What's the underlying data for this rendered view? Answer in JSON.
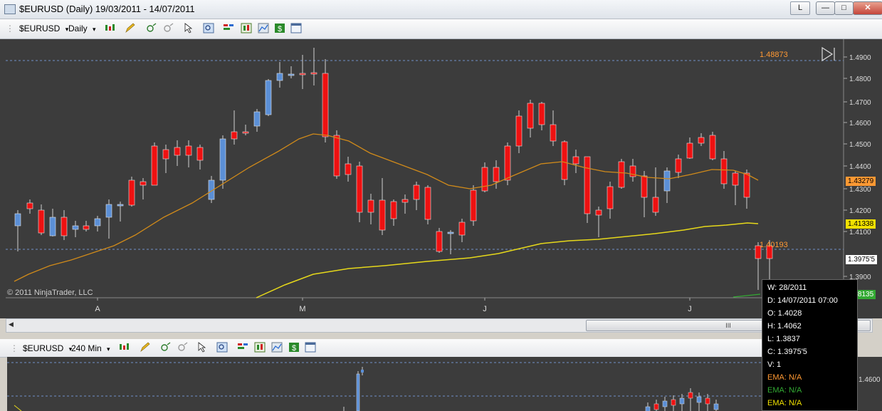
{
  "window": {
    "title": "$EURUSD (Daily)  19/03/2011 - 14/07/2011",
    "link_button": "L",
    "controls": [
      "minimize",
      "restore",
      "close"
    ]
  },
  "toolbar": {
    "instrument": "$EURUSD",
    "interval": "Daily",
    "dropdown_glyph": "▾"
  },
  "toolbar2": {
    "instrument": "$EURUSD",
    "interval": "240 Min"
  },
  "chart": {
    "copyright": "© 2011 NinjaTrader, LLC",
    "x_labels": [
      "A",
      "M",
      "J",
      "J"
    ],
    "y_ticks": [
      "1.4900",
      "1.4800",
      "1.4700",
      "1.4600",
      "1.4500",
      "1.4400",
      "1.4300",
      "1.4200",
      "1.4100",
      "1.3900"
    ],
    "lines": [
      {
        "label": "1.48873",
        "color": "#ff9933"
      },
      {
        "label": "1.40193",
        "color": "#ff9933"
      }
    ],
    "price_markers": [
      {
        "value": "1.43279",
        "color": "#ff9933"
      },
      {
        "value": "1.41338",
        "color": "#f0e000"
      },
      {
        "value": "1.3975'5",
        "color": "#ffffff"
      },
      {
        "value": "1.38135",
        "color": "#33aa33"
      }
    ],
    "colors": {
      "up": "#5b8fd6",
      "down": "#ee1111",
      "ema_fast": "#d08a1a",
      "ema_slow": "#e6d81a",
      "grid": "#6f8fc8",
      "background": "#3c3c3c"
    }
  },
  "lower_chart": {
    "y_tick": "1.4600"
  },
  "scrollbar": {
    "thumb_glyph": "III",
    "left_arrow": "◀",
    "right_arrow": "▶"
  },
  "tooltip": {
    "lines": [
      {
        "text": "W: 28/2011",
        "color": "#ffffff"
      },
      {
        "text": "D: 14/07/2011 07:00",
        "color": "#ffffff"
      },
      {
        "text": "O: 1.4028",
        "color": "#ffffff"
      },
      {
        "text": "H: 1.4062",
        "color": "#ffffff"
      },
      {
        "text": "L: 1.3837",
        "color": "#ffffff"
      },
      {
        "text": "C: 1.3975'5",
        "color": "#ffffff"
      },
      {
        "text": "V: 1",
        "color": "#ffffff"
      },
      {
        "text": "EMA: N/A",
        "color": "#ff9933"
      },
      {
        "text": "EMA: N/A",
        "color": "#33aa33"
      },
      {
        "text": "EMA: N/A",
        "color": "#f0e000"
      }
    ]
  }
}
